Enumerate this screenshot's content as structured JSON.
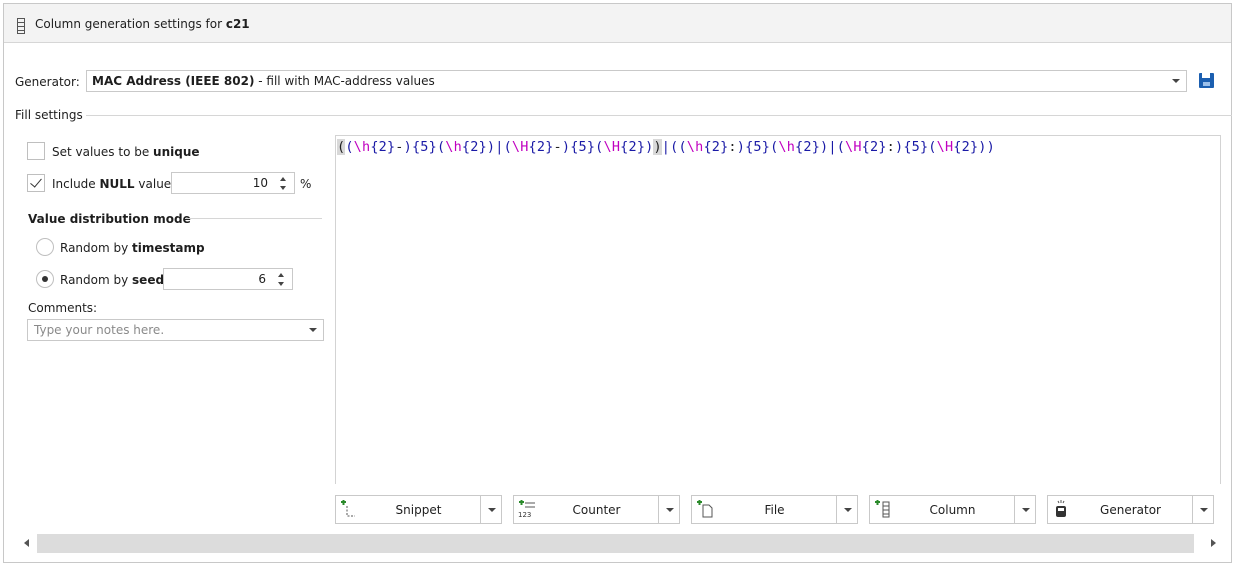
{
  "header": {
    "title_prefix": "Column generation settings for",
    "column": "c21",
    "icon": "column-icon"
  },
  "generator": {
    "label": "Generator:",
    "selected_name": "MAC Address (IEEE 802)",
    "selected_desc": " - fill with MAC-address values",
    "save_icon": "save-icon"
  },
  "fill_settings": {
    "title": "Fill settings",
    "unique": {
      "prefix": "Set values to be ",
      "bold": "unique",
      "checked": false
    },
    "include_null": {
      "prefix": "Include ",
      "bold": "NULL",
      "suffix": " values",
      "checked": true,
      "value": "10",
      "unit": "%"
    },
    "distribution": {
      "title": "Value distribution mode",
      "timestamp": {
        "prefix": "Random by ",
        "bold": "timestamp",
        "selected": false
      },
      "seed": {
        "prefix": "Random by ",
        "bold": "seed",
        "selected": true,
        "value": "6"
      }
    },
    "comments": {
      "label": "Comments:",
      "placeholder": "Type your notes here."
    }
  },
  "editor": {
    "expression": "((\\h{2}-){5}(\\h{2})|(\\H{2}-){5}(\\H{2}))|((\\h{2}:){5}(\\h{2})|(\\H{2}:){5}(\\H{2}))"
  },
  "toolbar": [
    {
      "label": "Snippet",
      "icon": "snippet-icon"
    },
    {
      "label": "Counter",
      "icon": "counter-icon"
    },
    {
      "label": "File",
      "icon": "file-icon"
    },
    {
      "label": "Column",
      "icon": "column-icon"
    },
    {
      "label": "Generator",
      "icon": "generator-icon"
    }
  ],
  "colors": {
    "accent": "#1c5fb0",
    "regex_bracket": "#1a1aa6",
    "regex_escape": "#c000c0"
  }
}
